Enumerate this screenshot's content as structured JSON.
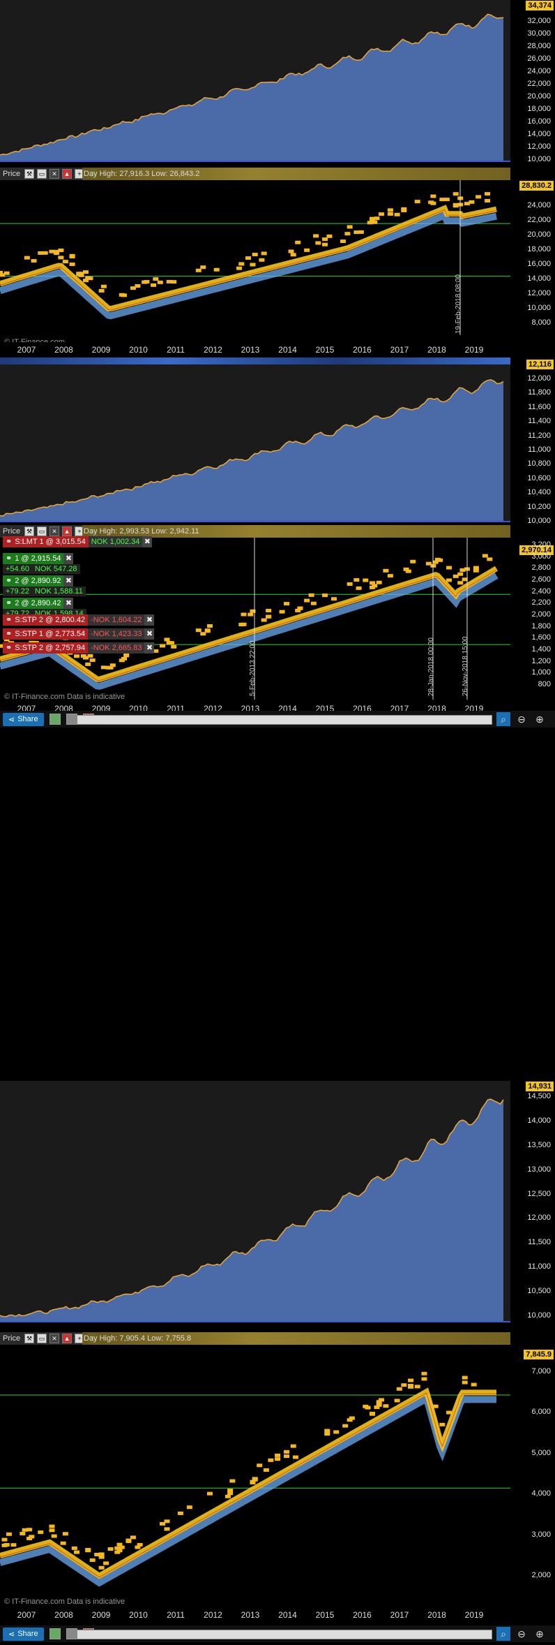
{
  "panels": [
    {
      "equity": {
        "top_label": "34,374",
        "ticks": [
          "32,000",
          "30,000",
          "28,000",
          "26,000",
          "24,000",
          "22,000",
          "20,000",
          "18,000",
          "16,000",
          "14,000",
          "12,000",
          "10,000"
        ]
      },
      "toolbar": {
        "label": "Price",
        "dayinfo": "Day High: 27,916.3  Low: 26,843.2"
      },
      "price": {
        "current": "28,830.2",
        "ticks": [
          "24,000",
          "22,000",
          "20,000",
          "18,000",
          "16,000",
          "14,000",
          "12,000",
          "10,000",
          "8,000"
        ],
        "vlabels": [
          "19-Feb-2018 08:00"
        ],
        "watermark": "© IT-Finance.com"
      },
      "years": [
        "2007",
        "2008",
        "2009",
        "2010",
        "2011",
        "2012",
        "2013",
        "2014",
        "2015",
        "2016",
        "2017",
        "2018",
        "2019"
      ]
    },
    {
      "equity": {
        "top_label": "12,116",
        "ticks": [
          "12,000",
          "11,800",
          "11,600",
          "11,400",
          "11,200",
          "11,000",
          "10,800",
          "10,600",
          "10,400",
          "10,200",
          "10,000"
        ]
      },
      "toolbar": {
        "label": "Price",
        "dayinfo": "Day High: 2,993.53  Low: 2,942.11"
      },
      "price": {
        "current": "2,970.14",
        "ticks": [
          "3,200",
          "3,000",
          "2,800",
          "2,600",
          "2,400",
          "2,200",
          "2,000",
          "1,800",
          "1,600",
          "1,400",
          "1,200",
          "1,000",
          "800"
        ],
        "vlabels": [
          "5-Feb-2013 22:00",
          "28-Jan-2018 00:00",
          "26-Nov-2018 15:00"
        ],
        "watermark": "© IT-Finance.com Data is indicative"
      },
      "orders": [
        {
          "tag": "S:LMT",
          "label": "S:LMT  1 @ 3,015.54",
          "value": "NOK 1,002.34",
          "type": "red"
        },
        {
          "tag": "buy",
          "label": "1 @ 2,915.54",
          "pnl1": "+54.60",
          "pnl2": "NOK 547.28",
          "type": "green"
        },
        {
          "tag": "buy",
          "label": "2 @ 2,890.92",
          "pnl1": "+79.22",
          "pnl2": "NOK 1,588.11",
          "type": "green"
        },
        {
          "tag": "buy",
          "label": "2 @ 2,890.42",
          "pnl1": "+79.72",
          "pnl2": "NOK 1,598.14",
          "type": "green"
        },
        {
          "tag": "S:STP",
          "label": "S:STP  2 @ 2,800.42",
          "value": "-NOK 1,604.22",
          "type": "red"
        },
        {
          "tag": "S:STP",
          "label": "S:STP  1 @ 2,773.54",
          "value": "-NOK 1,423.33",
          "type": "red"
        },
        {
          "tag": "S:STP",
          "label": "S:STP  2 @ 2,757.94",
          "value": "-NOK 2,665.83",
          "type": "red"
        }
      ],
      "years": [
        "2007",
        "2008",
        "2009",
        "2010",
        "2011",
        "2012",
        "2013",
        "2014",
        "2015",
        "2016",
        "2017",
        "2018",
        "2019"
      ]
    },
    {
      "equity": {
        "top_label": "14,931",
        "ticks": [
          "14,500",
          "14,000",
          "13,500",
          "13,000",
          "12,500",
          "12,000",
          "11,500",
          "11,000",
          "10,500",
          "10,000"
        ]
      },
      "toolbar": {
        "label": "Price",
        "dayinfo": "Day High: 7,905.4  Low: 7,755.8"
      },
      "price": {
        "current": "7,845.9",
        "ticks": [
          "7,000",
          "6,000",
          "5,000",
          "4,000",
          "3,000",
          "2,000"
        ],
        "vlabels": [],
        "watermark": "© IT-Finance.com Data is indicative"
      },
      "years": [
        "2007",
        "2008",
        "2009",
        "2010",
        "2011",
        "2012",
        "2013",
        "2014",
        "2015",
        "2016",
        "2017",
        "2018",
        "2019"
      ]
    }
  ],
  "bottombar": {
    "share_label": "Share"
  },
  "colors": {
    "equity_fill": "#4a6aa8",
    "equity_line": "#f0a830",
    "candle": "#f5c518",
    "band_blue": "#6aaaf0",
    "hline": "#2fd12f"
  }
}
